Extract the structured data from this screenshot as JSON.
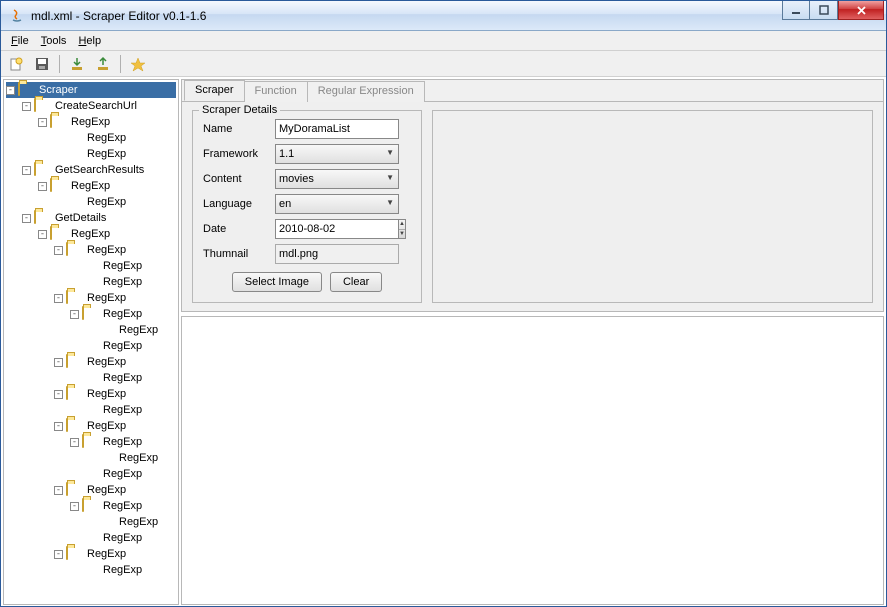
{
  "window": {
    "title": "mdl.xml - Scraper Editor v0.1-1.6"
  },
  "menu": {
    "file": "File",
    "tools": "Tools",
    "help": "Help"
  },
  "tabs": {
    "scraper": "Scraper",
    "function": "Function",
    "regex": "Regular Expression"
  },
  "details": {
    "title": "Scraper Details",
    "labels": {
      "name": "Name",
      "framework": "Framework",
      "content": "Content",
      "language": "Language",
      "date": "Date",
      "thumb": "Thumnail"
    },
    "values": {
      "name": "MyDoramaList",
      "framework": "1.1",
      "content": "movies",
      "language": "en",
      "date": "2010-08-02",
      "thumb": "mdl.png"
    },
    "buttons": {
      "select": "Select Image",
      "clear": "Clear"
    }
  },
  "tree": [
    {
      "d": 0,
      "t": "-",
      "i": "f",
      "l": "Scraper",
      "sel": true
    },
    {
      "d": 1,
      "t": "-",
      "i": "f",
      "l": "CreateSearchUrl"
    },
    {
      "d": 2,
      "t": "-",
      "i": "f",
      "l": "RegExp"
    },
    {
      "d": 3,
      "t": "",
      "i": "g",
      "l": "RegExp"
    },
    {
      "d": 3,
      "t": "",
      "i": "g",
      "l": "RegExp"
    },
    {
      "d": 1,
      "t": "-",
      "i": "f",
      "l": "GetSearchResults"
    },
    {
      "d": 2,
      "t": "-",
      "i": "f",
      "l": "RegExp"
    },
    {
      "d": 3,
      "t": "",
      "i": "g",
      "l": "RegExp"
    },
    {
      "d": 1,
      "t": "-",
      "i": "f",
      "l": "GetDetails"
    },
    {
      "d": 2,
      "t": "-",
      "i": "f",
      "l": "RegExp"
    },
    {
      "d": 3,
      "t": "-",
      "i": "f",
      "l": "RegExp"
    },
    {
      "d": 4,
      "t": "",
      "i": "g",
      "l": "RegExp"
    },
    {
      "d": 4,
      "t": "",
      "i": "g",
      "l": "RegExp"
    },
    {
      "d": 3,
      "t": "-",
      "i": "f",
      "l": "RegExp"
    },
    {
      "d": 4,
      "t": "-",
      "i": "f",
      "l": "RegExp"
    },
    {
      "d": 5,
      "t": "",
      "i": "g",
      "l": "RegExp"
    },
    {
      "d": 4,
      "t": "",
      "i": "g",
      "l": "RegExp"
    },
    {
      "d": 3,
      "t": "-",
      "i": "f",
      "l": "RegExp"
    },
    {
      "d": 4,
      "t": "",
      "i": "g",
      "l": "RegExp"
    },
    {
      "d": 3,
      "t": "-",
      "i": "f",
      "l": "RegExp"
    },
    {
      "d": 4,
      "t": "",
      "i": "g",
      "l": "RegExp"
    },
    {
      "d": 3,
      "t": "-",
      "i": "f",
      "l": "RegExp"
    },
    {
      "d": 4,
      "t": "-",
      "i": "f",
      "l": "RegExp"
    },
    {
      "d": 5,
      "t": "",
      "i": "g",
      "l": "RegExp"
    },
    {
      "d": 4,
      "t": "",
      "i": "g",
      "l": "RegExp"
    },
    {
      "d": 3,
      "t": "-",
      "i": "f",
      "l": "RegExp"
    },
    {
      "d": 4,
      "t": "-",
      "i": "f",
      "l": "RegExp"
    },
    {
      "d": 5,
      "t": "",
      "i": "g",
      "l": "RegExp"
    },
    {
      "d": 4,
      "t": "",
      "i": "g",
      "l": "RegExp"
    },
    {
      "d": 3,
      "t": "-",
      "i": "f",
      "l": "RegExp"
    },
    {
      "d": 4,
      "t": "",
      "i": "g",
      "l": "RegExp"
    }
  ]
}
